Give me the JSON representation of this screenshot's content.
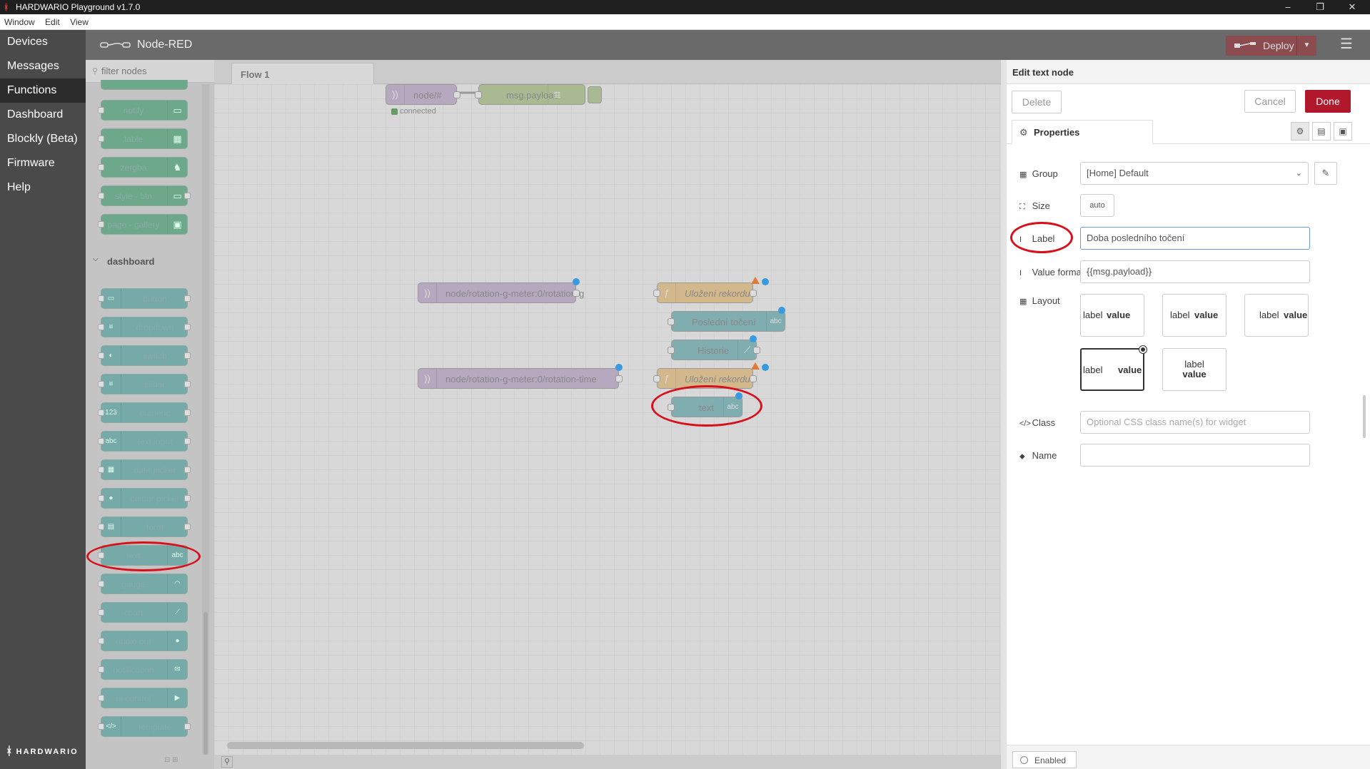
{
  "window": {
    "title": "HARDWARIO Playground v1.7.0",
    "logo": "hardwario-logo",
    "controls": {
      "minimize": "–",
      "maximize": "❐",
      "close": "✕"
    }
  },
  "menu": [
    "Window",
    "Edit",
    "View"
  ],
  "appnav": {
    "items": [
      "Devices",
      "Messages",
      "Functions",
      "Dashboard",
      "Blockly (Beta)",
      "Firmware",
      "Help"
    ],
    "active": "Functions",
    "brand": "HARDWARIO"
  },
  "nodered": {
    "title": "Node-RED",
    "deploy": "Deploy",
    "menu_icon": "☰"
  },
  "palette": {
    "filter_placeholder": "filter nodes",
    "top_nodes": [
      {
        "label": "notify",
        "icon": "▭"
      },
      {
        "label": "table",
        "icon": "▦"
      },
      {
        "label": "zergba",
        "icon": "♞"
      },
      {
        "label": "style - btn",
        "icon": "▭"
      },
      {
        "label": "page - gallery",
        "icon": "▣"
      }
    ],
    "dashboard_header": "dashboard",
    "dashboard_nodes": [
      {
        "label": "button",
        "icon": "▭"
      },
      {
        "label": "dropdown",
        "icon": "≡"
      },
      {
        "label": "switch",
        "icon": "◐"
      },
      {
        "label": "slider",
        "icon": "≡"
      },
      {
        "label": "numeric",
        "icon": "123"
      },
      {
        "label": "text input",
        "icon": "abc"
      },
      {
        "label": "date picker",
        "icon": "▦"
      },
      {
        "label": "colour picker",
        "icon": "●"
      },
      {
        "label": "form",
        "icon": "▤"
      },
      {
        "label": "text",
        "icon": "abc"
      },
      {
        "label": "gauge",
        "icon": "◠"
      },
      {
        "label": "chart",
        "icon": "⟋"
      },
      {
        "label": "audio out",
        "icon": "⦁"
      },
      {
        "label": "notification",
        "icon": "✉"
      },
      {
        "label": "ui control",
        "icon": "▶"
      },
      {
        "label": "template",
        "icon": "</>"
      }
    ]
  },
  "workspace": {
    "tab": "Flow 1",
    "nodes": {
      "mqtt_in": "node/#",
      "mqtt_status": "connected",
      "debug": "msg.payload",
      "rot_g": "node/rotation-g-meter:0/rotation-g",
      "func1": "Uložení rekordu",
      "last_rot": "Poslední točení",
      "history": "Historie",
      "rot_time": "node/rotation-g-meter:0/rotation-time",
      "func2": "Uložení rekordu",
      "text": "text"
    }
  },
  "editor": {
    "title": "Edit text node",
    "delete": "Delete",
    "cancel": "Cancel",
    "done": "Done",
    "tab": "Properties",
    "group_label": "Group",
    "group_value": "[Home] Default",
    "size_label": "Size",
    "size_value": "auto",
    "label_label": "Label",
    "label_value": "Doba posledního točení",
    "format_label": "Value format",
    "format_value": "{{msg.payload}}",
    "layout_label": "Layout",
    "layout_options": [
      "label",
      "value"
    ],
    "class_label": "Class",
    "class_placeholder": "Optional CSS class name(s) for widget",
    "name_label": "Name",
    "name_value": "",
    "enabled": "Enabled"
  },
  "colors": {
    "annotation": "#d8101c",
    "done_button": "#b2182c",
    "deploy_button": "#8c4b4e"
  }
}
